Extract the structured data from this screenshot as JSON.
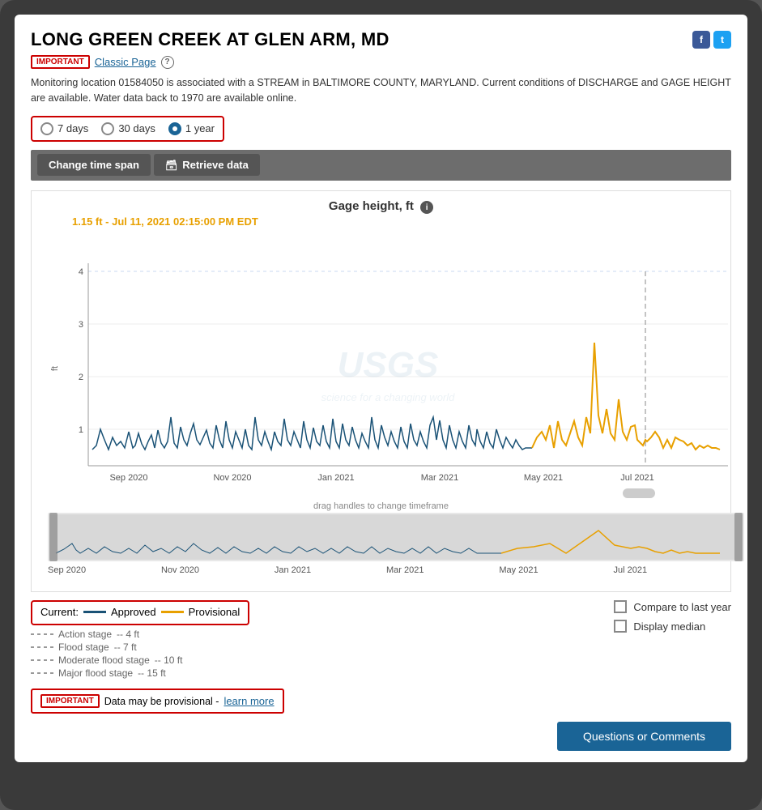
{
  "page": {
    "title": "LONG GREEN CREEK AT GLEN ARM, MD",
    "important_badge": "IMPORTANT",
    "classic_page_label": "Classic Page",
    "help_tooltip": "?",
    "description": "Monitoring location 01584050 is associated with a STREAM in BALTIMORE COUNTY, MARYLAND. Current conditions of DISCHARGE and GAGE HEIGHT are available. Water data back to 1970 are available online.",
    "social": {
      "facebook": "f",
      "twitter": "t"
    }
  },
  "radio_group": {
    "options": [
      {
        "label": "7 days",
        "selected": false
      },
      {
        "label": "30 days",
        "selected": false
      },
      {
        "label": "1 year",
        "selected": true
      }
    ]
  },
  "toolbar": {
    "change_time_span": "Change time span",
    "retrieve_data": "Retrieve data"
  },
  "chart": {
    "title": "Gage height, ft",
    "current_reading": "1.15 ft - Jul 11, 2021 02:15:00 PM EDT",
    "y_label": "ft",
    "x_labels": [
      "Sep 2020",
      "Nov 2020",
      "Jan 2021",
      "Mar 2021",
      "May 2021",
      "Jul 2021"
    ],
    "y_ticks": [
      "1",
      "2",
      "3",
      "4"
    ],
    "drag_hint": "drag handles to change timeframe",
    "watermark_line1": "USGS",
    "watermark_line2": "science for a changing world"
  },
  "legend": {
    "current_label": "Current:",
    "approved_label": "Approved",
    "provisional_label": "Provisional",
    "stages": [
      {
        "label": "Action stage",
        "value": "-- 4 ft"
      },
      {
        "label": "Flood stage",
        "value": "-- 7 ft"
      },
      {
        "label": "Moderate flood stage",
        "value": "-- 10 ft"
      },
      {
        "label": "Major flood stage",
        "value": "-- 15 ft"
      }
    ]
  },
  "checkboxes": {
    "compare_label": "Compare to last year",
    "median_label": "Display median"
  },
  "bottom": {
    "important_badge": "IMPORTANT",
    "notice_text": "Data may be provisional -",
    "learn_more": "learn more",
    "questions_btn": "Questions or Comments"
  }
}
